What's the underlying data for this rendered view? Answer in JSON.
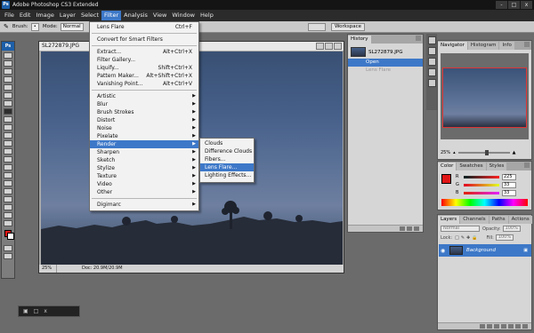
{
  "window": {
    "title": "Adobe Photoshop CS3 Extended",
    "app_icon": "Ps",
    "controls": [
      "-",
      "□",
      "x"
    ]
  },
  "menubar": {
    "items": [
      "File",
      "Edit",
      "Image",
      "Layer",
      "Select",
      "Filter",
      "Analysis",
      "View",
      "Window",
      "Help"
    ],
    "active": "Filter"
  },
  "options_bar": {
    "brush_label": "Brush:",
    "mode_label": "Mode:",
    "mode_value": "Normal",
    "workspace_label": "Workspace"
  },
  "toolbox": {
    "logo": "Ps",
    "foreground_color": "#e01515",
    "background_color": "#ffffff"
  },
  "document": {
    "title": "SL272879.JPG",
    "zoom": "25%",
    "status": "Doc: 20.9M/20.9M"
  },
  "filter_menu": {
    "last_filter": {
      "label": "Lens Flare",
      "shortcut": "Ctrl+F"
    },
    "convert": "Convert for Smart Filters",
    "extract": {
      "label": "Extract...",
      "shortcut": "Alt+Ctrl+X"
    },
    "gallery": {
      "label": "Filter Gallery..."
    },
    "liquify": {
      "label": "Liquify...",
      "shortcut": "Shift+Ctrl+X"
    },
    "pattern": {
      "label": "Pattern Maker...",
      "shortcut": "Alt+Shift+Ctrl+X"
    },
    "vanishing": {
      "label": "Vanishing Point...",
      "shortcut": "Alt+Ctrl+V"
    },
    "submenus": [
      "Artistic",
      "Blur",
      "Brush Strokes",
      "Distort",
      "Noise",
      "Pixelate",
      "Render",
      "Sharpen",
      "Sketch",
      "Stylize",
      "Texture",
      "Video",
      "Other"
    ],
    "highlighted": "Render",
    "digimarc": "Digimarc"
  },
  "render_submenu": {
    "items": [
      "Clouds",
      "Difference Clouds",
      "Fibers...",
      "Lens Flare...",
      "Lighting Effects..."
    ],
    "highlighted": "Lens Flare..."
  },
  "history_panel": {
    "tab": "History",
    "snapshot": "SL272879.JPG",
    "states": [
      {
        "label": "Open",
        "active": true
      },
      {
        "label": "Lens Flare",
        "active": false
      }
    ]
  },
  "navigator_panel": {
    "tabs": [
      "Navigator",
      "Histogram",
      "Info"
    ],
    "zoom": "25%"
  },
  "color_panel": {
    "tabs": [
      "Color",
      "Swatches",
      "Styles"
    ],
    "channels": [
      {
        "label": "R",
        "value": "225"
      },
      {
        "label": "G",
        "value": "33"
      },
      {
        "label": "B",
        "value": "33"
      }
    ]
  },
  "layers_panel": {
    "tabs": [
      "Layers",
      "Channels",
      "Paths",
      "Actions"
    ],
    "blend_mode": "Normal",
    "opacity_label": "Opacity:",
    "opacity": "100%",
    "lock_label": "Lock:",
    "fill_label": "Fill:",
    "fill": "100%",
    "layer_name": "Background"
  }
}
